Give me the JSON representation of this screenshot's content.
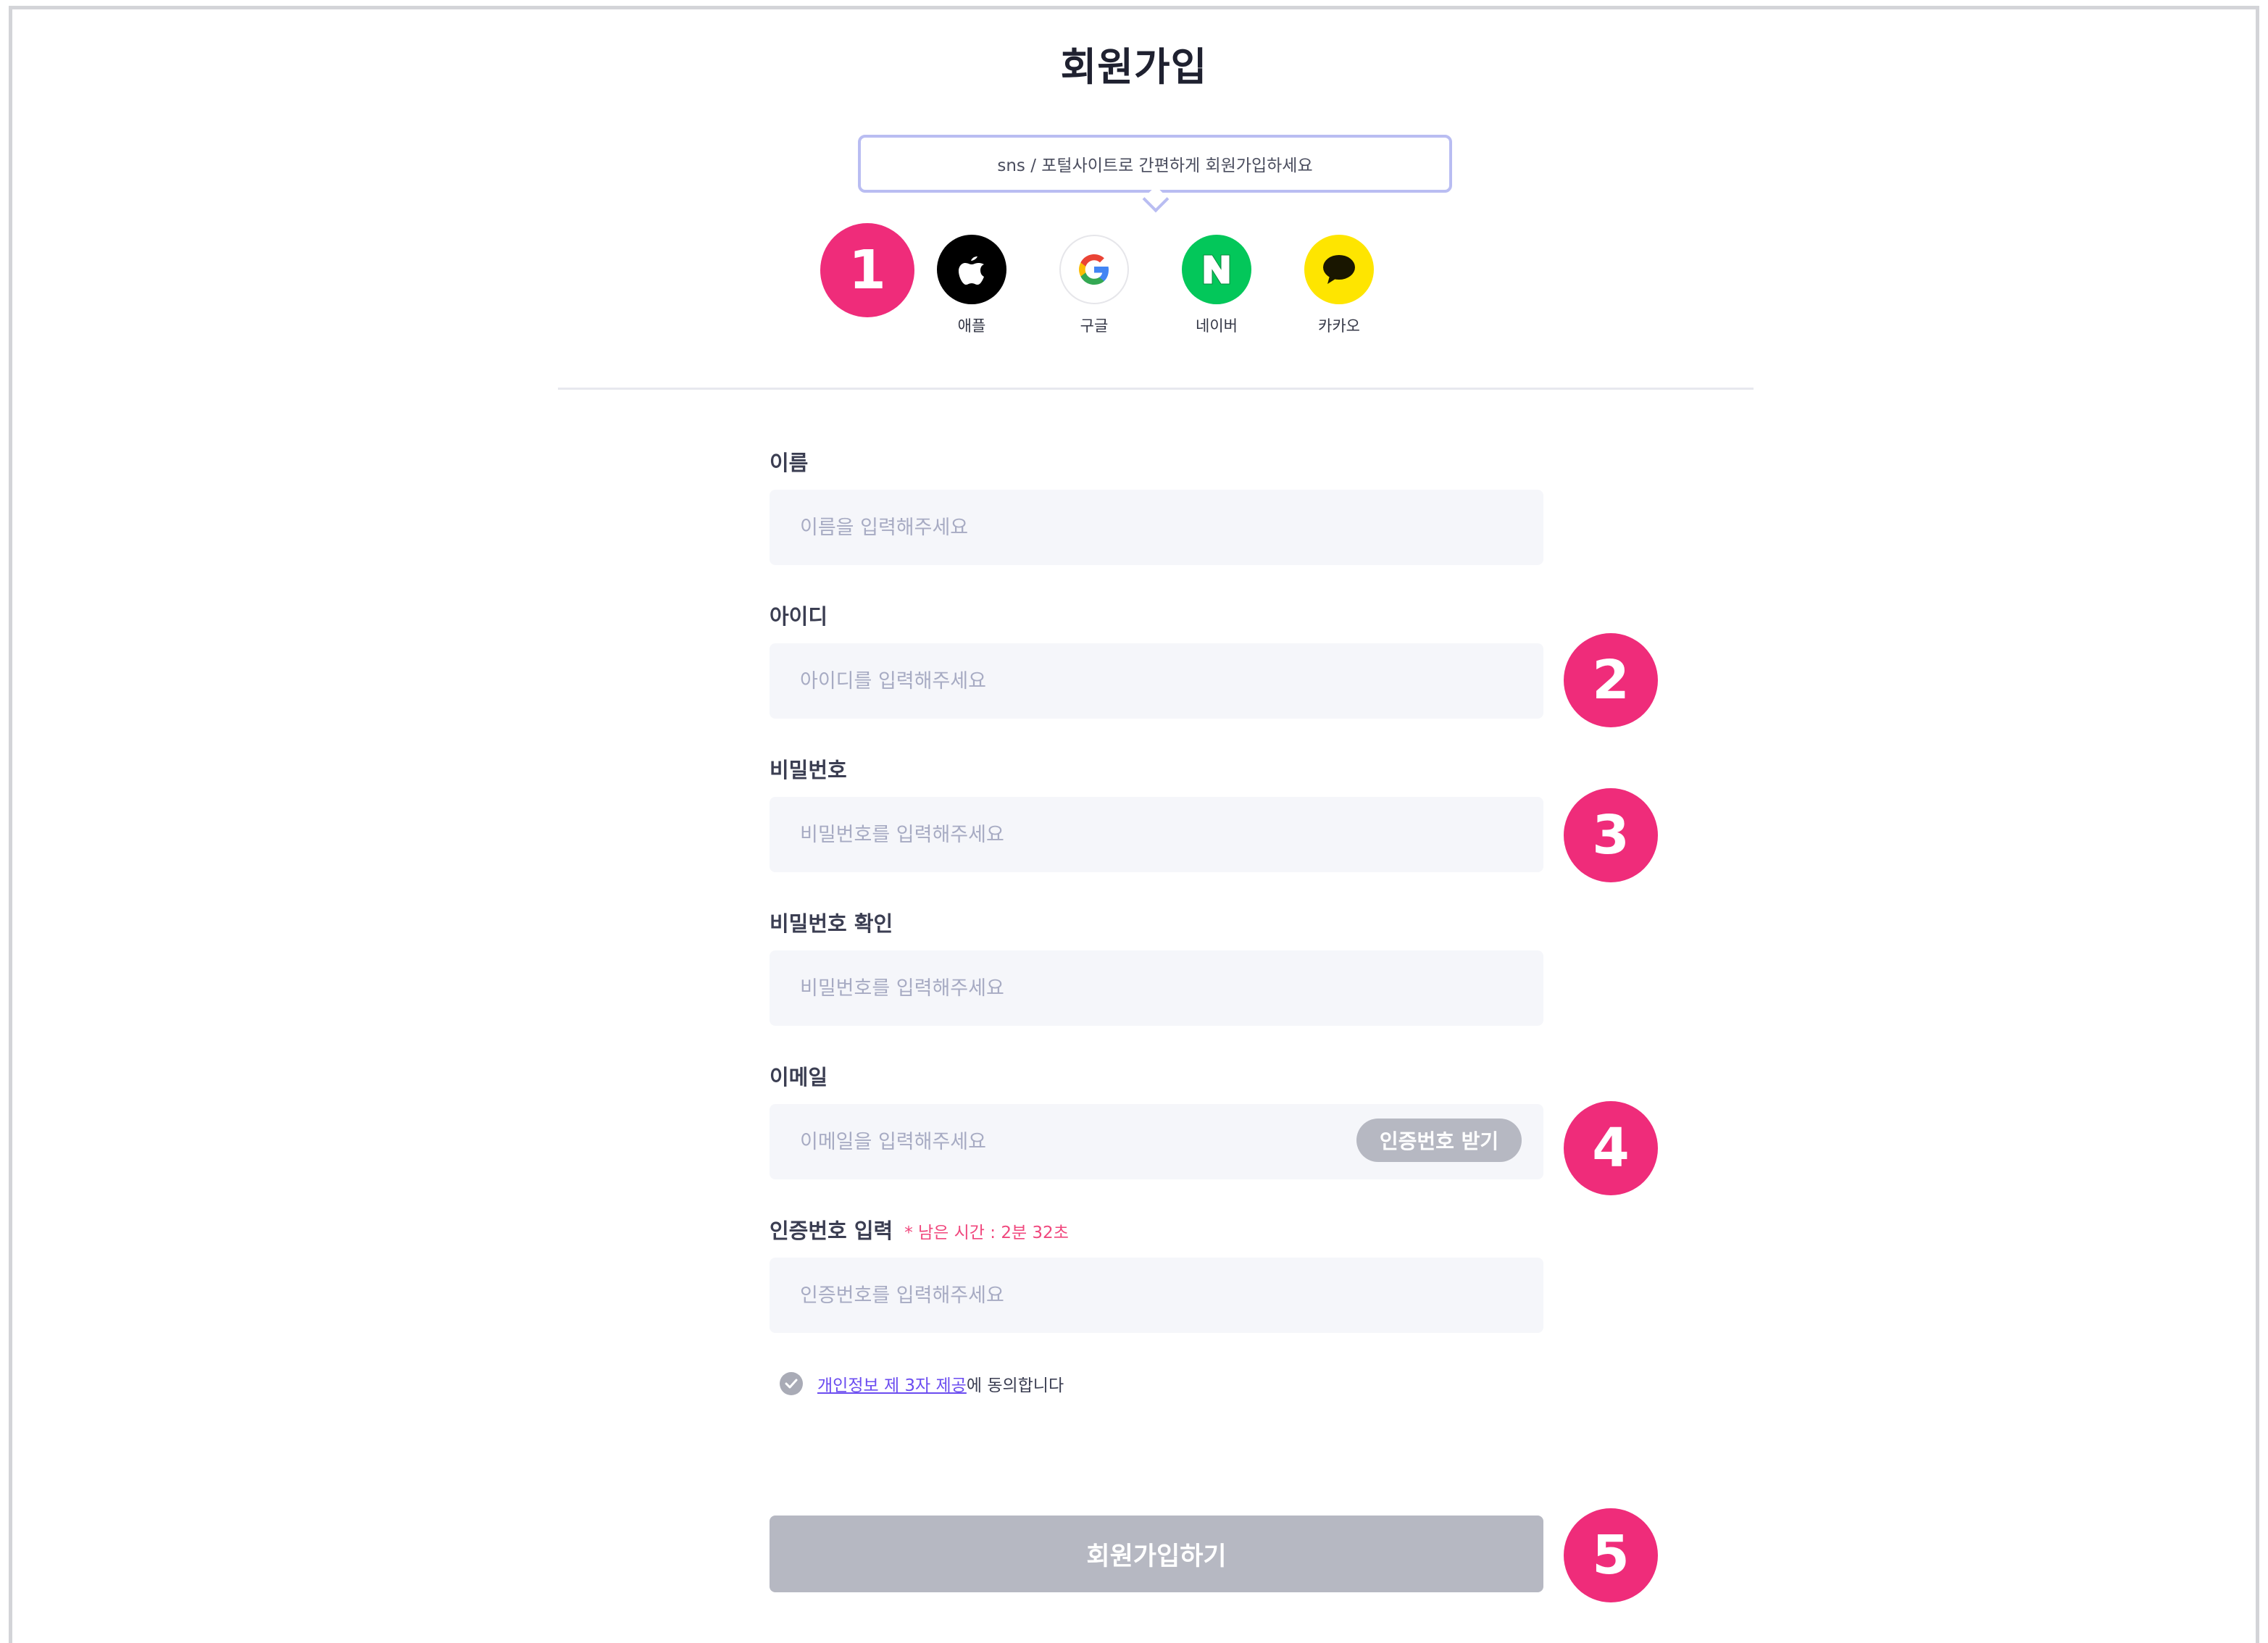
{
  "page": {
    "title": "회원가입"
  },
  "sns": {
    "tooltip": "sns / 포털사이트로 간편하게 회원가입하세요",
    "providers": [
      {
        "label": "애플",
        "icon": "apple-icon",
        "color": "#000000"
      },
      {
        "label": "구글",
        "icon": "google-icon",
        "color": "#ffffff"
      },
      {
        "label": "네이버",
        "icon": "naver-icon",
        "color": "#03c75a"
      },
      {
        "label": "카카오",
        "icon": "kakao-icon",
        "color": "#fee500"
      }
    ]
  },
  "form": {
    "name": {
      "label": "이름",
      "placeholder": "이름을 입력해주세요",
      "value": ""
    },
    "id": {
      "label": "아이디",
      "placeholder": "아이디를 입력해주세요",
      "value": ""
    },
    "password": {
      "label": "비밀번호",
      "placeholder": "비밀번호를 입력해주세요",
      "value": ""
    },
    "password_confirm": {
      "label": "비밀번호 확인",
      "placeholder": "비밀번호를 입력해주세요",
      "value": ""
    },
    "email": {
      "label": "이메일",
      "placeholder": "이메일을 입력해주세요",
      "value": "",
      "verify_button": "인증번호 받기"
    },
    "code": {
      "label": "인증번호 입력",
      "timer": "* 남은 시간 : 2분 32초",
      "placeholder": "인증번호를 입력해주세요",
      "value": ""
    }
  },
  "consent": {
    "link_text": "개인정보 제 3자 제공",
    "suffix": "에 동의합니다"
  },
  "submit": {
    "label": "회원가입하기"
  },
  "markers": [
    "1",
    "2",
    "3",
    "4",
    "5"
  ],
  "colors": {
    "marker": "#ef2c7a",
    "accent_border": "#b9bdf2",
    "disabled": "#b6b8c2",
    "input_bg": "#f5f6fa",
    "link": "#6b4cf0"
  }
}
